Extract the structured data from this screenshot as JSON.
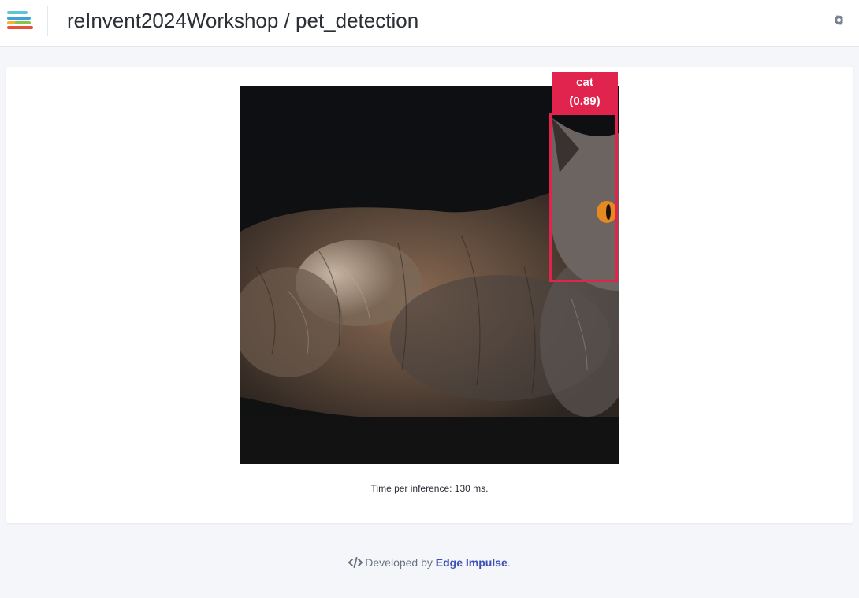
{
  "header": {
    "title": "reInvent2024Workshop / pet_detection",
    "logo_colors": [
      "#5dc6d6",
      "#3aa3d8",
      "#f2b233",
      "#e94f3c"
    ],
    "settings_icon": "gear-icon"
  },
  "detection": {
    "label": "cat",
    "score": "(0.89)",
    "box_color": "#e0244e",
    "image_subject": "cat"
  },
  "inference": {
    "text": "Time per inference: 130 ms."
  },
  "footer": {
    "prefix": "Developed by ",
    "link_text": "Edge Impulse",
    "suffix": ".",
    "icon": "code-icon",
    "link_color": "#3d4fb8"
  }
}
